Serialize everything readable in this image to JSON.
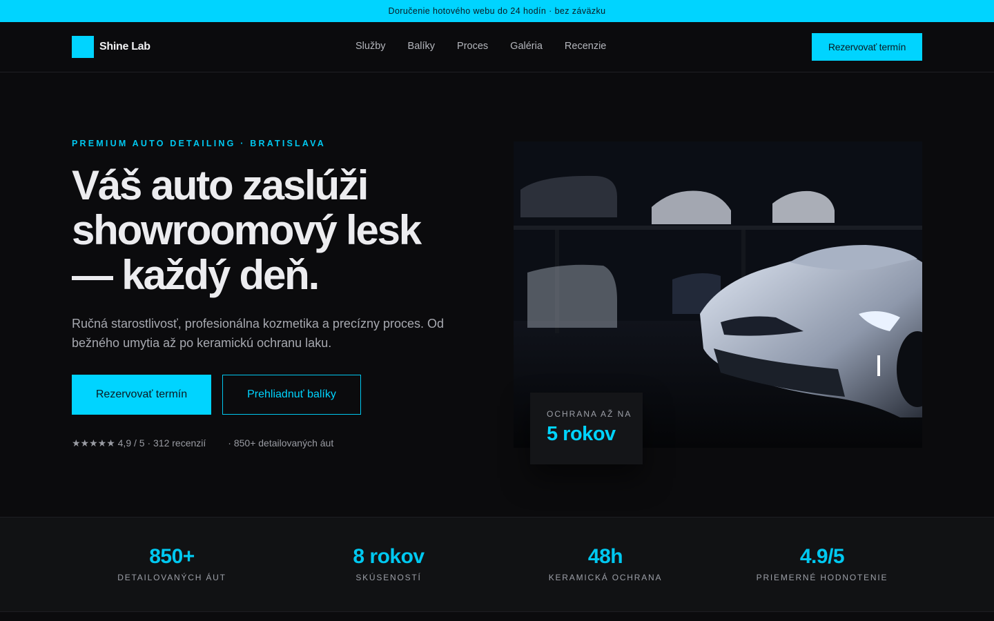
{
  "announcement": "Doručenie hotového webu do 24 hodín · bez záväzku",
  "brand": {
    "name": "Shine Lab",
    "accent": "#00d4ff"
  },
  "nav": {
    "links": [
      "Služby",
      "Balíky",
      "Proces",
      "Galéria",
      "Recenzie"
    ],
    "cta": "Rezervovať termín"
  },
  "hero": {
    "eyebrow": "PREMIUM AUTO DETAILING · BRATISLAVA",
    "headline_lines": [
      "Váš auto zaslúži",
      "showroomový lesk",
      "— každý deň."
    ],
    "lead": "Ručná starostlivosť, profesionálna kozmetika a precízny proces. Od bežného umytia až po keramickú ochranu laku.",
    "primary_cta": "Rezervovať termín",
    "secondary_cta": "Prehliadnuť balíky",
    "rating": "★★★★★ 4,9 / 5 · 312 recenzií",
    "cars_count": "· 850+ detailovaných áut",
    "image_icon": "car-photo",
    "badge": {
      "label": "OCHRANA AŽ NA",
      "value": "5 rokov"
    }
  },
  "stats": [
    {
      "value": "850+",
      "label": "DETAILOVANÝCH ÁUT"
    },
    {
      "value": "8 rokov",
      "label": "SKÚSENOSTÍ"
    },
    {
      "value": "48h",
      "label": "KERAMICKÁ OCHRANA"
    },
    {
      "value": "4.9/5",
      "label": "PRIEMERNÉ HODNOTENIE"
    }
  ]
}
